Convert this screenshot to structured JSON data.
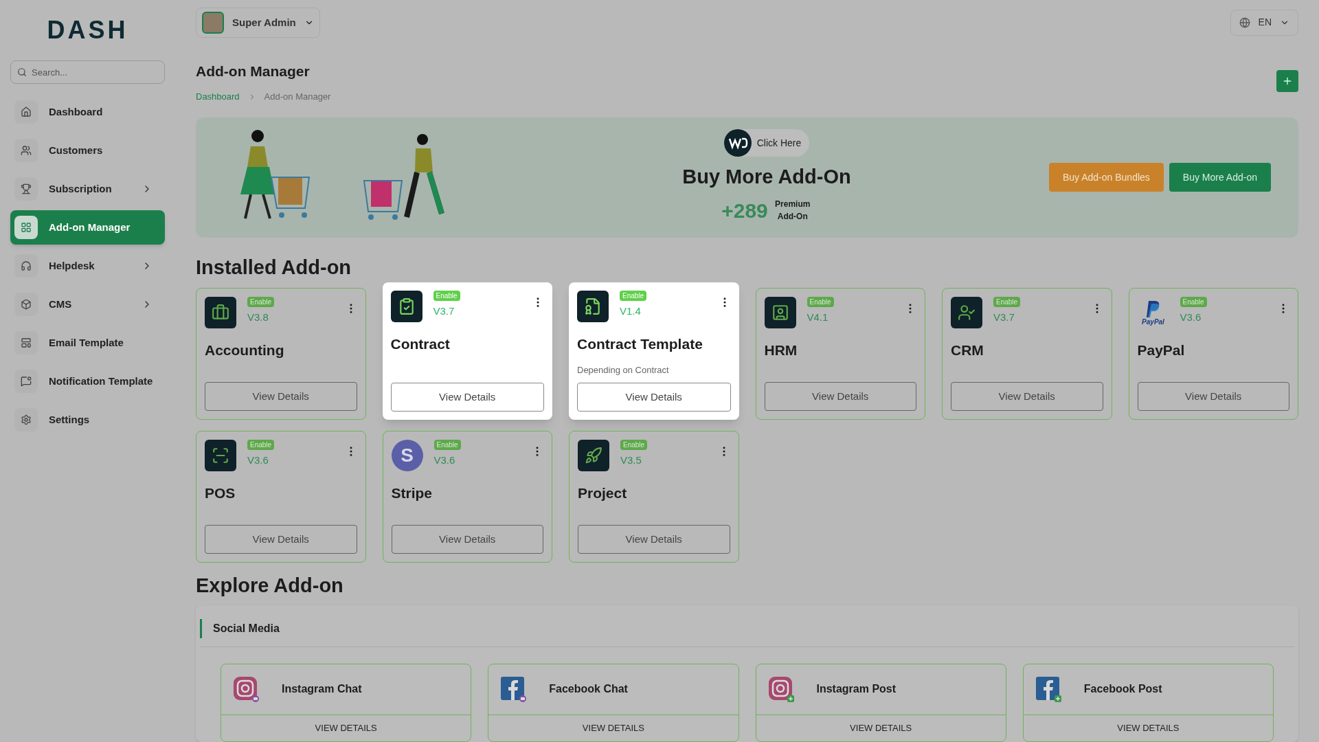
{
  "logo": "DASH",
  "search": {
    "placeholder": "Search..."
  },
  "sidebar": {
    "items": [
      {
        "label": "Dashboard",
        "selected": false,
        "has_submenu": false
      },
      {
        "label": "Customers",
        "selected": false,
        "has_submenu": false
      },
      {
        "label": "Subscription",
        "selected": false,
        "has_submenu": true
      },
      {
        "label": "Add-on Manager",
        "selected": true,
        "has_submenu": false
      },
      {
        "label": "Helpdesk",
        "selected": false,
        "has_submenu": true
      },
      {
        "label": "CMS",
        "selected": false,
        "has_submenu": true
      },
      {
        "label": "Email Template",
        "selected": false,
        "has_submenu": false
      },
      {
        "label": "Notification Template",
        "selected": false,
        "has_submenu": false
      },
      {
        "label": "Settings",
        "selected": false,
        "has_submenu": false
      }
    ]
  },
  "header": {
    "user": "Super Admin",
    "language": "EN"
  },
  "page": {
    "title": "Add-on Manager",
    "breadcrumb": [
      "Dashboard",
      "Add-on Manager"
    ]
  },
  "banner": {
    "link": "Click Here",
    "title": "Buy More Add-On",
    "count": "+289",
    "count_label": "Premium Add-On",
    "buttons": [
      {
        "label": "Buy Add-on Bundles",
        "kind": "secondary"
      },
      {
        "label": "Buy More Add-on",
        "kind": "primary"
      }
    ]
  },
  "installed": {
    "title": "Installed Add-on",
    "cards": [
      {
        "name": "Accounting",
        "kind": "tile",
        "badge": "Enable",
        "version": "V3.8",
        "button": "View Details",
        "highlighted": false
      },
      {
        "name": "Contract",
        "kind": "tile",
        "badge": "Enable",
        "version": "V3.7",
        "button": "View Details",
        "highlighted": true
      },
      {
        "name": "Contract Template",
        "kind": "tile",
        "badge": "Enable",
        "version": "V1.4",
        "note": "Depending on Contract",
        "button": "View Details",
        "highlighted": true
      },
      {
        "name": "HRM",
        "kind": "tile",
        "badge": "Enable",
        "version": "V4.1",
        "button": "View Details",
        "highlighted": false
      },
      {
        "name": "CRM",
        "kind": "tile",
        "badge": "Enable",
        "version": "V3.7",
        "button": "View Details",
        "highlighted": false
      },
      {
        "name": "PayPal",
        "kind": "paypal",
        "logo_text": "PayPal",
        "badge": "Enable",
        "version": "V3.6",
        "button": "View Details",
        "highlighted": false
      },
      {
        "name": "POS",
        "kind": "tile",
        "badge": "Enable",
        "version": "V3.6",
        "button": "View Details",
        "highlighted": false
      },
      {
        "name": "Stripe",
        "kind": "stripe",
        "logo_text": "S",
        "badge": "Enable",
        "version": "V3.6",
        "button": "View Details",
        "highlighted": false
      },
      {
        "name": "Project",
        "kind": "tile",
        "badge": "Enable",
        "version": "V3.5",
        "button": "View Details",
        "highlighted": false
      }
    ]
  },
  "explore": {
    "title": "Explore Add-on",
    "category": "Social Media",
    "cards": [
      {
        "name": "Instagram Chat",
        "button": "VIEW DETAILS"
      },
      {
        "name": "Facebook Chat",
        "button": "VIEW DETAILS"
      },
      {
        "name": "Instagram Post",
        "button": "VIEW DETAILS"
      },
      {
        "name": "Facebook Post",
        "button": "VIEW DETAILS"
      }
    ]
  }
}
